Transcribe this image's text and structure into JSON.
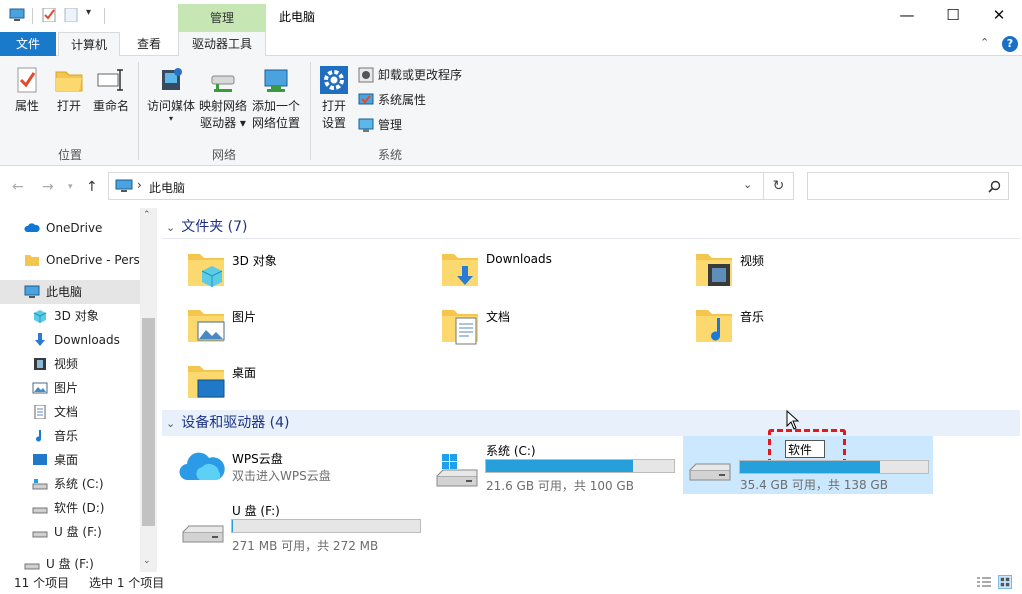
{
  "window": {
    "title": "此电脑",
    "context_tab": "管理",
    "controls": {
      "minimize": "—",
      "maximize": "☐",
      "close": "✕"
    }
  },
  "ribbon_tabs": [
    {
      "label": "文件"
    },
    {
      "label": "计算机"
    },
    {
      "label": "查看"
    },
    {
      "label": "驱动器工具"
    }
  ],
  "ribbon": {
    "location": {
      "label": "位置",
      "buttons": [
        "属性",
        "打开",
        "重命名"
      ]
    },
    "network": {
      "label": "网络",
      "media": "访问媒体",
      "map_line1": "映射网络",
      "map_line2": "驱动器",
      "add_line1": "添加一个",
      "add_line2": "网络位置"
    },
    "system": {
      "label": "系统",
      "open_line1": "打开",
      "open_line2": "设置",
      "uninstall": "卸载或更改程序",
      "sysprops": "系统属性",
      "manage": "管理"
    }
  },
  "address": {
    "path": "此电脑",
    "separator": "›",
    "search_placeholder": ""
  },
  "sidebar": {
    "items": [
      {
        "label": "OneDrive",
        "icon": "cloud-icon"
      },
      {
        "label": "OneDrive - Perso",
        "icon": "folder-icon"
      },
      {
        "label": "此电脑",
        "icon": "computer-icon",
        "selected": true
      },
      {
        "label": "3D 对象",
        "icon": "cube-icon"
      },
      {
        "label": "Downloads",
        "icon": "download-icon"
      },
      {
        "label": "视频",
        "icon": "video-icon"
      },
      {
        "label": "图片",
        "icon": "picture-icon"
      },
      {
        "label": "文档",
        "icon": "document-icon"
      },
      {
        "label": "音乐",
        "icon": "music-icon"
      },
      {
        "label": "桌面",
        "icon": "desktop-icon"
      },
      {
        "label": "系统 (C:)",
        "icon": "drive-icon"
      },
      {
        "label": "软件 (D:)",
        "icon": "drive-icon"
      },
      {
        "label": "U 盘 (F:)",
        "icon": "usb-drive-icon"
      },
      {
        "label": "U 盘 (F:)",
        "icon": "usb-drive-icon"
      }
    ]
  },
  "folders": {
    "header": "文件夹 (7)",
    "items": [
      "3D 对象",
      "Downloads",
      "视频",
      "图片",
      "文档",
      "音乐",
      "桌面"
    ]
  },
  "devices": {
    "header": "设备和驱动器 (4)",
    "wps": {
      "name": "WPS云盘",
      "sub": "双击进入WPS云盘"
    },
    "c": {
      "name": "系统 (C:)",
      "usage": "21.6 GB 可用，共 100 GB",
      "fill": 0.784
    },
    "d": {
      "rename_value": "软件",
      "usage": "35.4 GB 可用，共 138 GB",
      "fill": 0.743
    },
    "f": {
      "name": "U 盘 (F:)",
      "usage": "271 MB 可用，共 272 MB",
      "fill": 0.004
    }
  },
  "status": {
    "count": "11 个项目",
    "selected": "选中 1 个项目"
  },
  "colors": {
    "accent": "#1979ca",
    "drive_fill": "#26a0da",
    "selection": "#cce8ff",
    "header_text": "#1e3287",
    "rename_outline": "#e0191e"
  }
}
